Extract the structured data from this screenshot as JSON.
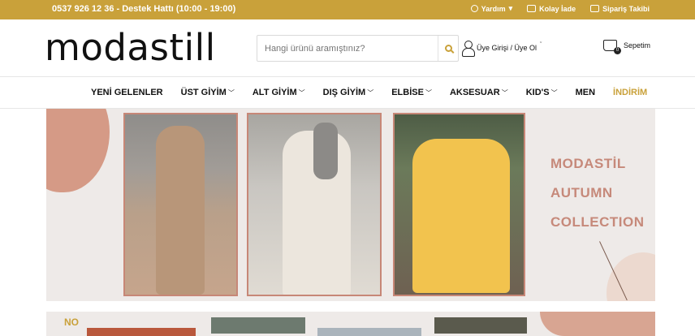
{
  "topbar": {
    "contact": "0537 926 12 36 - Destek Hattı (10:00 - 19:00)",
    "help": "Yardım",
    "easy_return": "Kolay İade",
    "order_tracking": "Sipariş Takibi"
  },
  "header": {
    "logo": "modastill",
    "search_placeholder": "Hangi ürünü aramıştınız?",
    "account": "Üye Girişi / Üye Ol",
    "cart": "Sepetim",
    "cart_count": "0"
  },
  "nav": {
    "items": [
      {
        "label": "YENİ GELENLER",
        "dropdown": false
      },
      {
        "label": "ÜST GİYİM",
        "dropdown": true
      },
      {
        "label": "ALT GİYİM",
        "dropdown": true
      },
      {
        "label": "DIŞ GİYİM",
        "dropdown": true
      },
      {
        "label": "ELBİSE",
        "dropdown": true
      },
      {
        "label": "AKSESUAR",
        "dropdown": true
      },
      {
        "label": "KID'S",
        "dropdown": true
      },
      {
        "label": "MEN",
        "dropdown": false
      },
      {
        "label": "İNDİRİM",
        "dropdown": false
      }
    ]
  },
  "banner": {
    "line1": "MODASTİL",
    "line2": "AUTUMN",
    "line3": "COLLECTION"
  },
  "strip": {
    "vertical_text": "NO"
  },
  "colors": {
    "accent": "#c9a13a",
    "banner_text": "#c6897a"
  }
}
